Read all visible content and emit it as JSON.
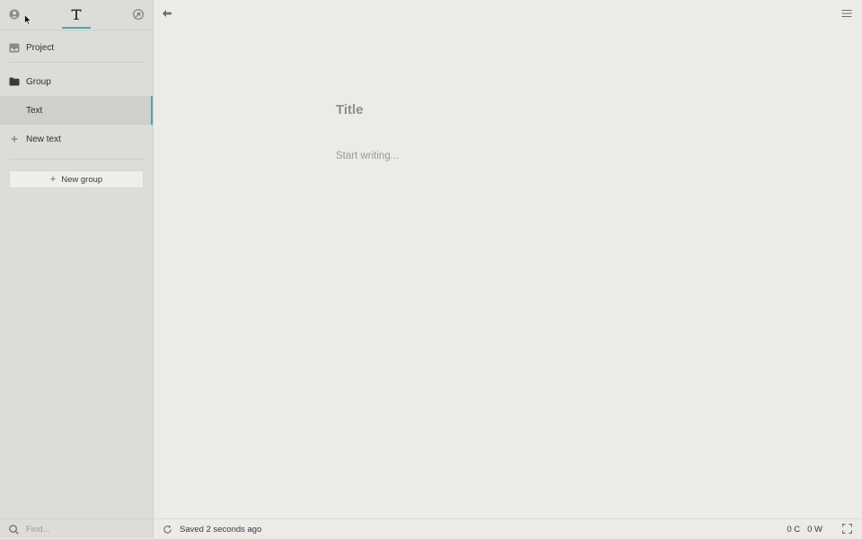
{
  "sidebar": {
    "tabs": [
      {
        "icon": "user-icon"
      },
      {
        "icon": "text-format-icon",
        "active": true
      },
      {
        "icon": "search-globe-icon"
      }
    ],
    "items": [
      {
        "label": "Project",
        "icon": "inbox-icon"
      },
      {
        "label": "Group",
        "icon": "folder-icon"
      },
      {
        "label": "Text",
        "active": true
      },
      {
        "label": "New text",
        "icon": "plus-icon"
      }
    ],
    "new_group_label": "New group",
    "find_placeholder": "Find..."
  },
  "editor": {
    "title_placeholder": "Title",
    "body_placeholder": "Start writing..."
  },
  "status": {
    "saved_text": "Saved 2 seconds ago",
    "char_count": "0 C",
    "word_count": "0 W"
  },
  "colors": {
    "accent": "#4aa8b8",
    "sidebar_bg": "#dcdcd9",
    "editor_bg": "#ebebe7"
  }
}
